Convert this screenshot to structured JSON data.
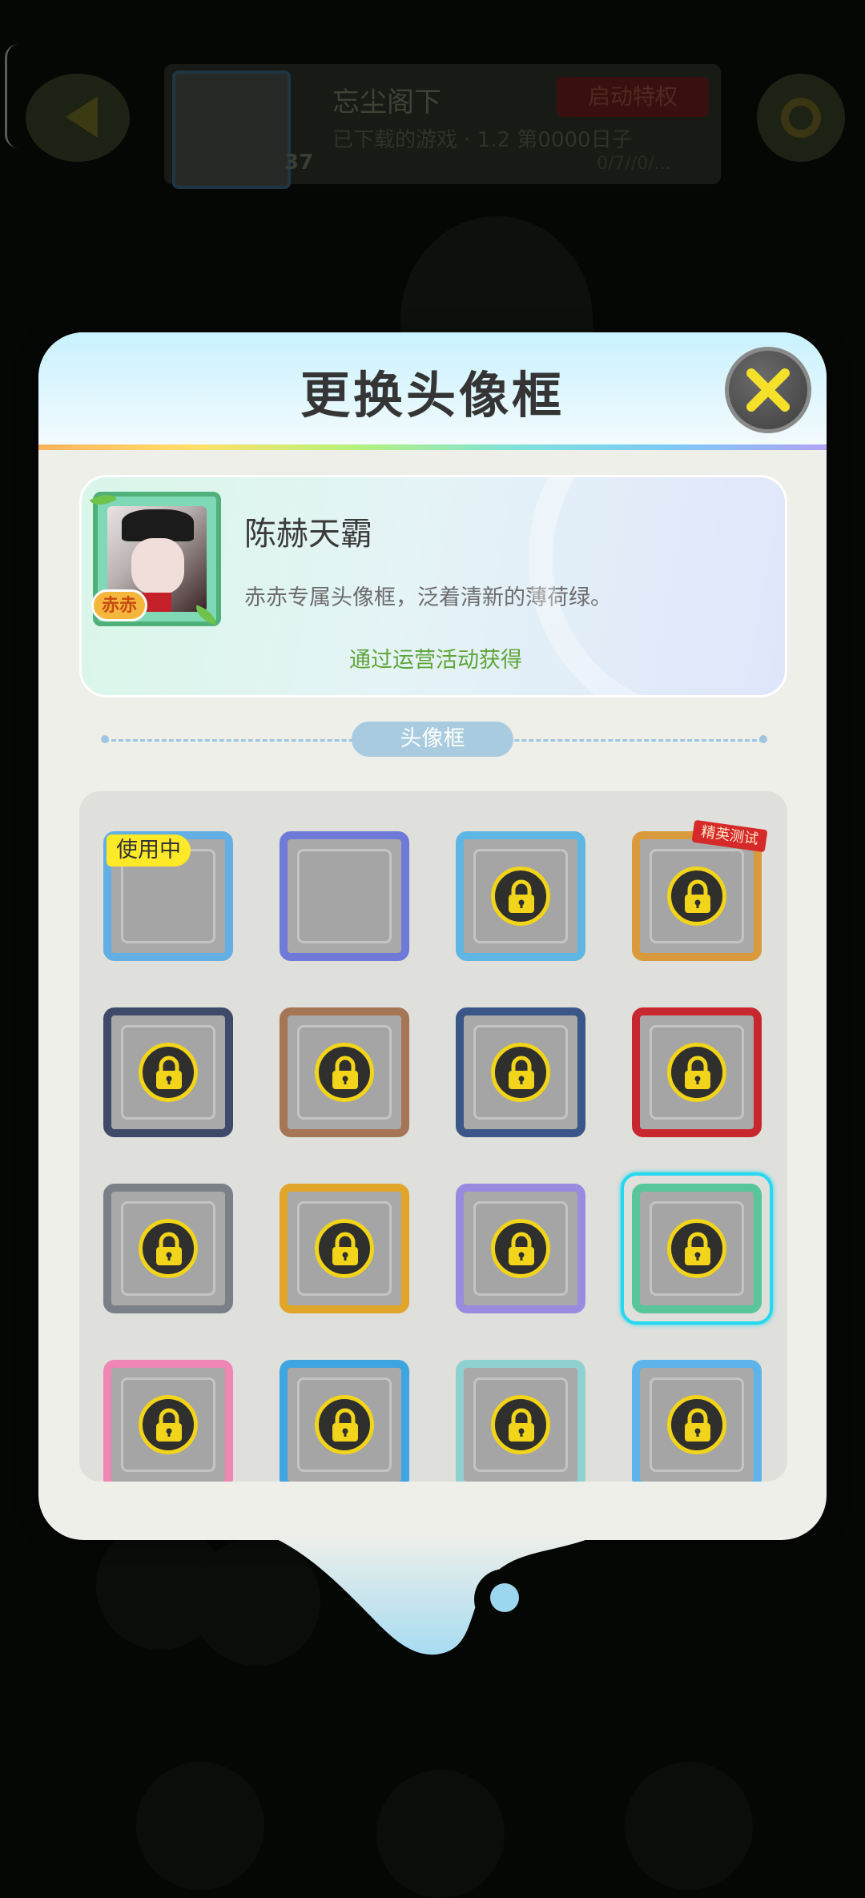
{
  "background": {
    "player_name": "忘尘阁下",
    "level": "37",
    "privilege_button": "启动特权",
    "sub_line": "已下载的游戏 · 1.2 第0000日子",
    "sub_line2": "0/7//0/..."
  },
  "modal": {
    "title": "更换头像框",
    "close_icon": "close-icon",
    "selected_frame": {
      "name": "陈赫天霸",
      "description": "赤赤专属头像框，泛着清新的薄荷绿。",
      "source": "通过运营活动获得",
      "badge_text": "赤赤"
    },
    "section_label": "头像框",
    "in_use_label": "使用中",
    "ribbon_label": "精英测试",
    "frames": [
      {
        "id": "frame-1",
        "color": "#63aee3",
        "locked": false,
        "in_use": true,
        "selected": false
      },
      {
        "id": "frame-2",
        "color": "#6f7ad8",
        "locked": false,
        "in_use": false,
        "selected": false
      },
      {
        "id": "frame-3",
        "color": "#5fb6e3",
        "locked": true,
        "in_use": false,
        "selected": false
      },
      {
        "id": "frame-4",
        "color": "#d89a3c",
        "locked": true,
        "in_use": false,
        "selected": false
      },
      {
        "id": "frame-5",
        "color": "#3f4a6a",
        "locked": true,
        "in_use": false,
        "selected": false
      },
      {
        "id": "frame-6",
        "color": "#a67556",
        "locked": true,
        "in_use": false,
        "selected": false
      },
      {
        "id": "frame-7",
        "color": "#3b5688",
        "locked": true,
        "in_use": false,
        "selected": false
      },
      {
        "id": "frame-8",
        "color": "#c9272f",
        "locked": true,
        "in_use": false,
        "selected": false
      },
      {
        "id": "frame-9",
        "color": "#7b7f87",
        "locked": true,
        "in_use": false,
        "selected": false
      },
      {
        "id": "frame-10",
        "color": "#e0a52a",
        "locked": true,
        "in_use": false,
        "selected": false
      },
      {
        "id": "frame-11",
        "color": "#9a8be0",
        "locked": true,
        "in_use": false,
        "selected": false
      },
      {
        "id": "frame-12",
        "color": "#58c59b",
        "locked": true,
        "in_use": false,
        "selected": true
      },
      {
        "id": "frame-13",
        "color": "#ef86b4",
        "locked": true,
        "in_use": false,
        "selected": false
      },
      {
        "id": "frame-14",
        "color": "#3fa5e0",
        "locked": true,
        "in_use": false,
        "selected": false
      },
      {
        "id": "frame-15",
        "color": "#8fd0d0",
        "locked": true,
        "in_use": false,
        "selected": false
      },
      {
        "id": "frame-16",
        "color": "#5cb4ea",
        "locked": true,
        "in_use": false,
        "selected": false
      }
    ]
  },
  "colors": {
    "accent_lock_ring": "#f2d41b",
    "selected_ring": "#25d8f0",
    "source_text": "#5ea53a"
  }
}
